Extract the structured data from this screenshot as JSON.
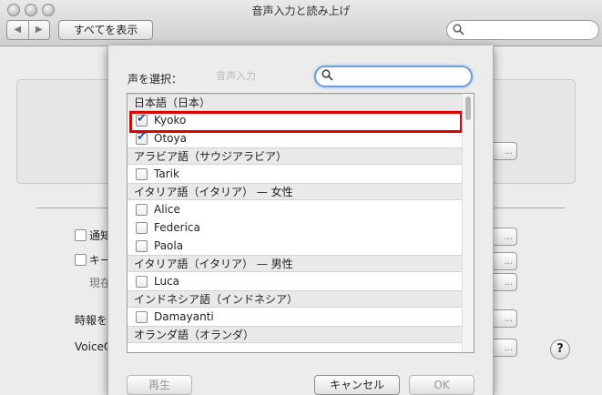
{
  "window": {
    "title": "音声入力と読み上げ",
    "show_all_label": "すべてを表示",
    "nav_back": "◀",
    "nav_forward": "▶"
  },
  "background": {
    "row_notify": "通知",
    "row_key": "キー",
    "row_current": "現在",
    "row_timesignal": "時報を",
    "row_voiceover": "VoiceO",
    "ellipsis": "..."
  },
  "sheet": {
    "label": "声を選択：",
    "ghost_tab": "音声入力",
    "search_value": "",
    "list": [
      {
        "type": "group",
        "label": "日本語（日本）"
      },
      {
        "type": "item",
        "label": "Kyoko",
        "checked": true
      },
      {
        "type": "item",
        "label": "Otoya",
        "checked": true
      },
      {
        "type": "group",
        "label": "アラビア語（サウジアラビア）"
      },
      {
        "type": "item",
        "label": "Tarik",
        "checked": false
      },
      {
        "type": "group",
        "label": "イタリア語（イタリア） — 女性"
      },
      {
        "type": "item",
        "label": "Alice",
        "checked": false
      },
      {
        "type": "item",
        "label": "Federica",
        "checked": false
      },
      {
        "type": "item",
        "label": "Paola",
        "checked": false
      },
      {
        "type": "group",
        "label": "イタリア語（イタリア） — 男性"
      },
      {
        "type": "item",
        "label": "Luca",
        "checked": false
      },
      {
        "type": "group",
        "label": "インドネシア語（インドネシア）"
      },
      {
        "type": "item",
        "label": "Damayanti",
        "checked": false
      },
      {
        "type": "group",
        "label": "オランダ語（オランダ）"
      }
    ],
    "play_button": "再生",
    "cancel_button": "キャンセル",
    "ok_button": "OK"
  },
  "icons": {
    "search": "search-icon",
    "help": "?"
  },
  "colors": {
    "highlight": "#e00000",
    "checkmark": "#1a4fa8",
    "focus_ring": "#6d9fdc"
  }
}
